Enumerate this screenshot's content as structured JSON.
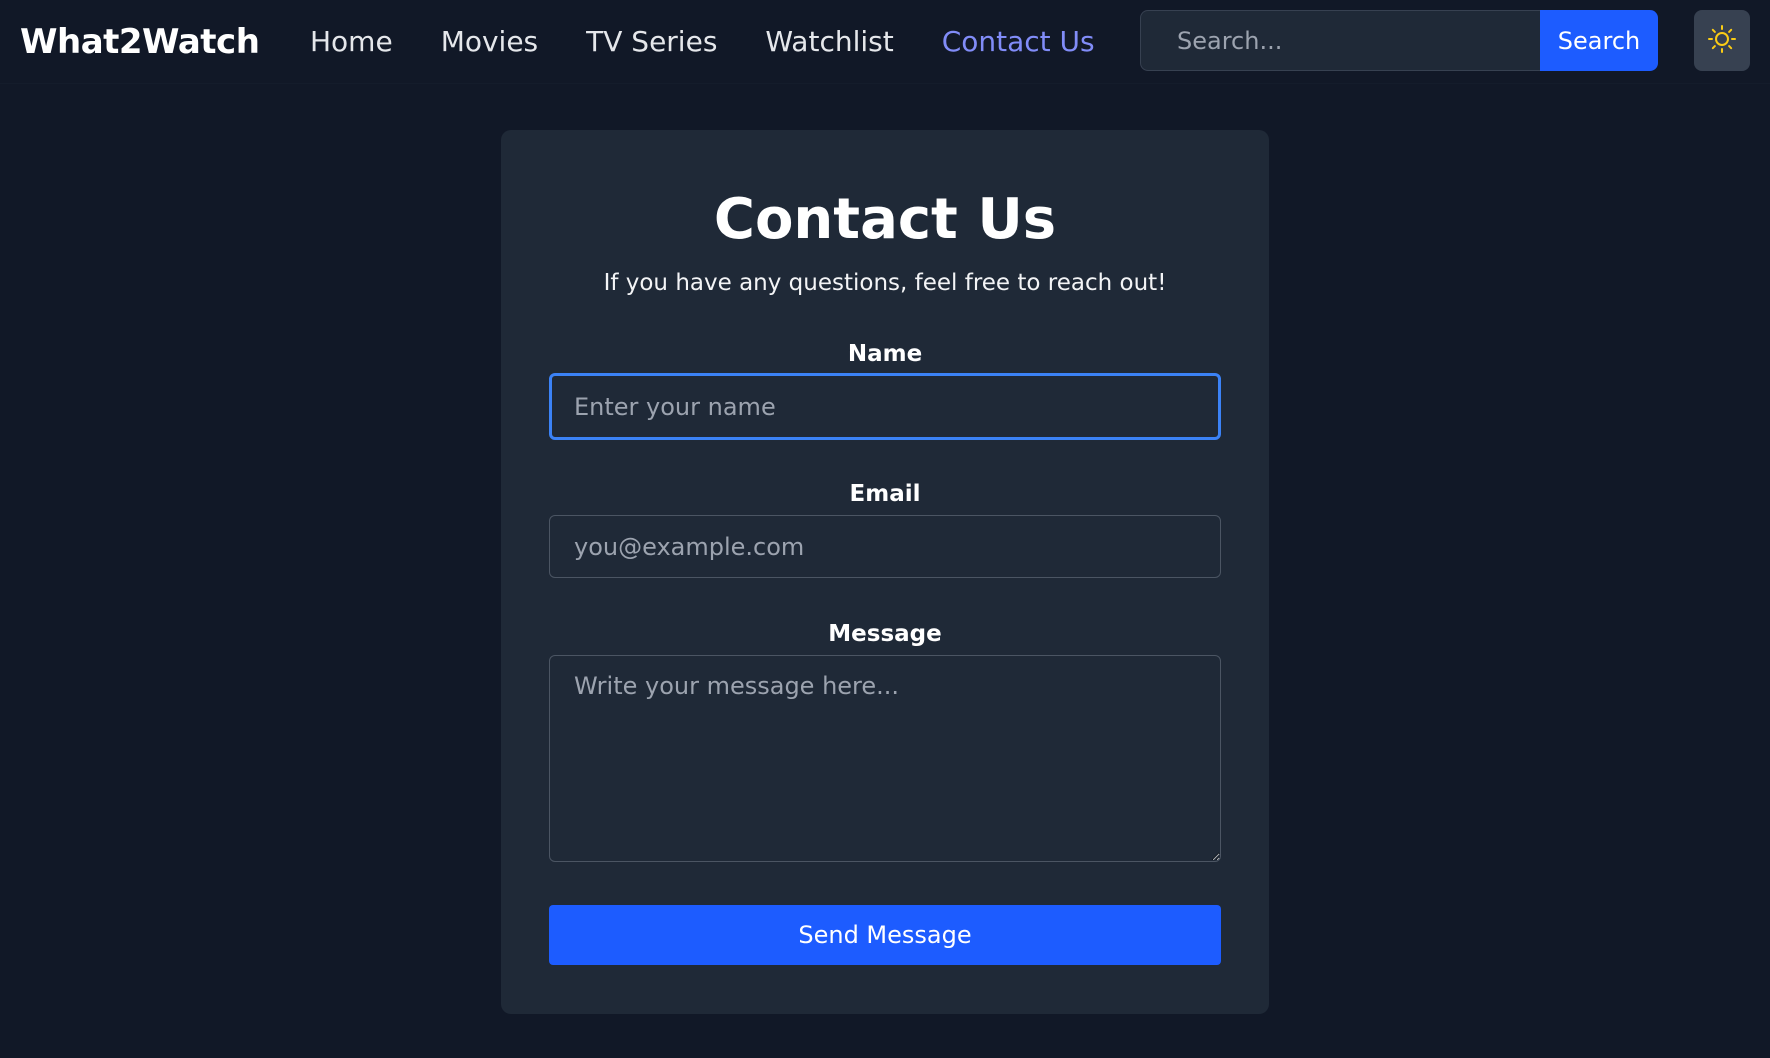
{
  "app": {
    "brand": "What2Watch"
  },
  "nav": {
    "items": [
      {
        "label": "Home"
      },
      {
        "label": "Movies"
      },
      {
        "label": "TV Series"
      },
      {
        "label": "Watchlist"
      },
      {
        "label": "Contact Us"
      }
    ],
    "active": "Contact Us"
  },
  "search": {
    "placeholder": "Search...",
    "value": "",
    "button_label": "Search"
  },
  "theme_toggle": {
    "icon": "sun-icon",
    "icon_color": "#facc15"
  },
  "contact": {
    "title": "Contact Us",
    "subtitle": "If you have any questions, feel free to reach out!",
    "name": {
      "label": "Name",
      "placeholder": "Enter your name",
      "value": ""
    },
    "email": {
      "label": "Email",
      "placeholder": "you@example.com",
      "value": ""
    },
    "message": {
      "label": "Message",
      "placeholder": "Write your message here...",
      "value": ""
    },
    "submit_label": "Send Message"
  },
  "colors": {
    "background": "#111827",
    "card": "#1f2937",
    "accent": "#1d5cff",
    "active_link": "#818cf8",
    "focus_ring": "#3b82f6"
  }
}
